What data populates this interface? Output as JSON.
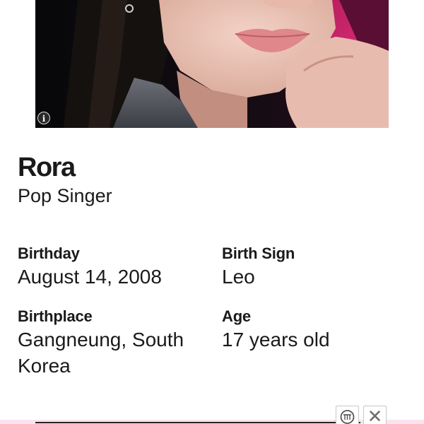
{
  "profile": {
    "name": "Rora",
    "occupation": "Pop Singer",
    "photo_alt": "Rora"
  },
  "facts": {
    "birthday_label": "Birthday",
    "birthday_value": "August 14, 2008",
    "birthsign_label": "Birth Sign",
    "birthsign_value": "Leo",
    "birthplace_label": "Birthplace",
    "birthplace_value": "Gangneung, South Korea",
    "age_label": "Age",
    "age_value": "17 years old"
  },
  "icons": {
    "photo_info": "info-icon",
    "ad_choices": "ad-choices-icon",
    "ad_close": "close-icon"
  },
  "colors": {
    "background": "#ffffff",
    "text": "#1a1a1a",
    "ad_strip": "#fbe3ef",
    "hair_highlight": "#d8206e"
  }
}
